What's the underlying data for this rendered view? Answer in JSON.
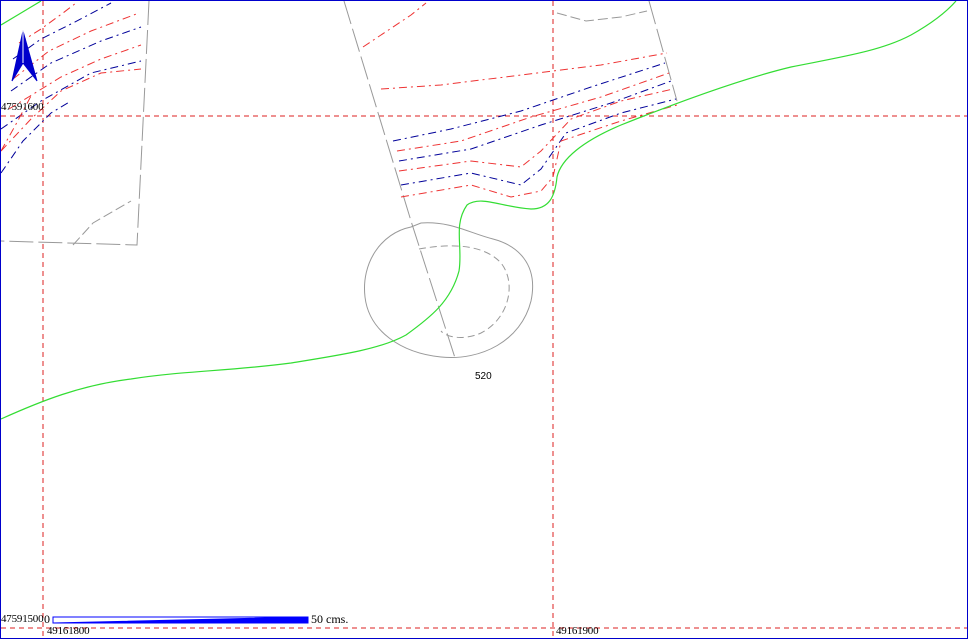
{
  "colors": {
    "grid": "#dd2222",
    "contour_red": "#ee3333",
    "contour_blue": "#000099",
    "boundary_gray": "#999999",
    "road_green": "#33dd33",
    "north_arrow": "#0000cc",
    "scale_bar": "#0000ff",
    "frame": "#0000cc"
  },
  "grid_labels": {
    "northing_upper": "47591600",
    "northing_lower": "47591500",
    "easting_left": "49161800",
    "easting_right": "49161900"
  },
  "elevation_label": "520",
  "scale": {
    "zero_label": "0",
    "end_label": "50 cms."
  },
  "icons": {
    "north": "north-arrow-icon"
  }
}
